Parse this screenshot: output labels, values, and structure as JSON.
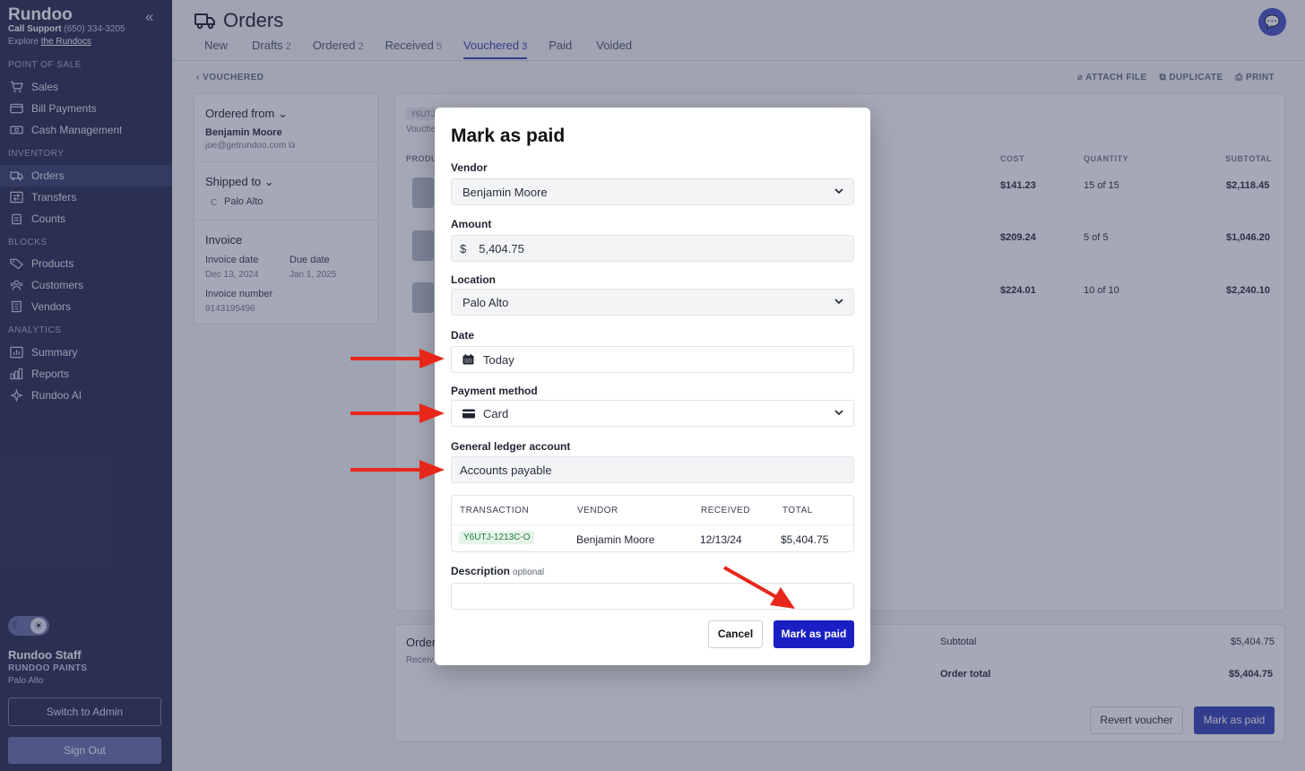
{
  "sidebar": {
    "brand": "Rundoo",
    "support_label": "Call Support",
    "support_phone": "(650) 334-3205",
    "explore_prefix": "Explore",
    "explore_link": "the Rundocs",
    "sections": {
      "pos": "POINT OF SALE",
      "inventory": "INVENTORY",
      "blocks": "BLOCKS",
      "analytics": "ANALYTICS"
    },
    "items": {
      "sales": "Sales",
      "bill_payments": "Bill Payments",
      "cash_management": "Cash Management",
      "orders": "Orders",
      "transfers": "Transfers",
      "counts": "Counts",
      "products": "Products",
      "customers": "Customers",
      "vendors": "Vendors",
      "summary": "Summary",
      "reports": "Reports",
      "rundoo_ai": "Rundoo AI"
    },
    "user_name": "Rundoo Staff",
    "company": "RUNDOO PAINTS",
    "location": "Palo Alto",
    "switch_admin": "Switch to Admin",
    "sign_out": "Sign Out"
  },
  "header": {
    "title": "Orders",
    "tabs": [
      {
        "label": "New",
        "count": ""
      },
      {
        "label": "Drafts",
        "count": "2"
      },
      {
        "label": "Ordered",
        "count": "2"
      },
      {
        "label": "Received",
        "count": "5"
      },
      {
        "label": "Vouchered",
        "count": "3"
      },
      {
        "label": "Paid",
        "count": ""
      },
      {
        "label": "Voided",
        "count": ""
      }
    ],
    "back_label": "VOUCHERED",
    "attach_file": "ATTACH FILE",
    "duplicate": "DUPLICATE",
    "print": "PRINT"
  },
  "details": {
    "ordered_from_label": "Ordered from",
    "vendor_name": "Benjamin Moore",
    "vendor_email": "joe@getrundoo.com",
    "shipped_to_label": "Shipped to",
    "shipped_badge": "C",
    "shipped_to_value": "Palo Alto",
    "invoice_label": "Invoice",
    "invoice_date_label": "Invoice date",
    "invoice_date": "Dec 13, 2024",
    "due_date_label": "Due date",
    "due_date": "Jan 1, 2025",
    "invoice_number_label": "Invoice number",
    "invoice_number": "9143195496"
  },
  "order_table": {
    "badge_prefix": "Y6UTJ",
    "sub_prefix": "Vouche",
    "product_header": "PRODU",
    "headers": {
      "cost": "COST",
      "quantity": "QUANTITY",
      "subtotal": "SUBTOTAL"
    },
    "rows": [
      {
        "cost": "$141.23",
        "quantity": "15 of 15",
        "subtotal": "$2,118.45"
      },
      {
        "cost": "$209.24",
        "quantity": "5 of 5",
        "subtotal": "$1,046.20"
      },
      {
        "cost": "$224.01",
        "quantity": "10 of 10",
        "subtotal": "$2,240.10"
      }
    ]
  },
  "summary": {
    "title_prefix": "Order",
    "sub_prefix": "Receiv",
    "subtotal_label": "Subtotal",
    "subtotal": "$5,404.75",
    "order_total_label": "Order total",
    "order_total": "$5,404.75",
    "revert_voucher": "Revert voucher",
    "mark_as_paid": "Mark as paid"
  },
  "modal": {
    "title": "Mark as paid",
    "vendor_label": "Vendor",
    "vendor_value": "Benjamin Moore",
    "amount_label": "Amount",
    "currency": "$",
    "amount_value": "5,404.75",
    "location_label": "Location",
    "location_value": "Palo Alto",
    "date_label": "Date",
    "date_value": "Today",
    "payment_label": "Payment method",
    "payment_value": "Card",
    "gl_label": "General ledger account",
    "gl_value": "Accounts payable",
    "tx_headers": {
      "transaction": "TRANSACTION",
      "vendor": "VENDOR",
      "received": "RECEIVED",
      "total": "TOTAL"
    },
    "tx_row": {
      "id": "Y6UTJ-1213C-O",
      "vendor": "Benjamin Moore",
      "received": "12/13/24",
      "total": "$5,404.75"
    },
    "description_label": "Description",
    "description_optional": "optional",
    "description_value": "",
    "cancel": "Cancel",
    "submit": "Mark as paid"
  },
  "colors": {
    "sidebar_bg": "#2c3152",
    "accent": "#3c48b8",
    "submit": "#1a1fc4",
    "annotation_arrow": "#e8271b"
  }
}
